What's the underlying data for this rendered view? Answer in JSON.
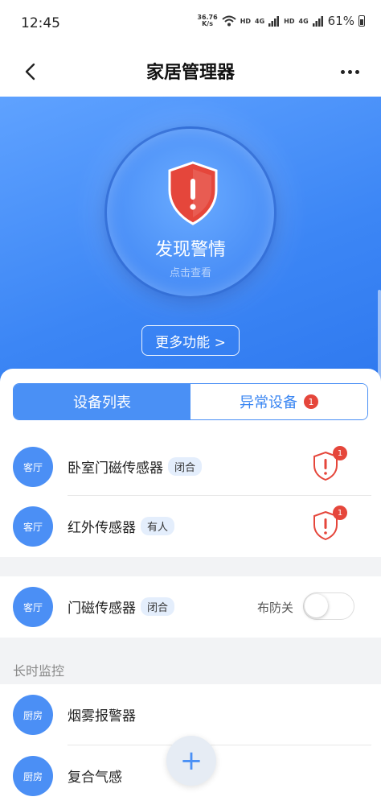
{
  "status_bar": {
    "time": "12:45",
    "net_speed_value": "36.76",
    "net_speed_unit": "K/s",
    "hd1": "HD",
    "net1": "4G",
    "hd2": "HD",
    "net2": "4G",
    "battery": "61%"
  },
  "nav": {
    "title": "家居管理器",
    "back_icon": "chevron-left-icon",
    "more_icon": "more-horizontal-icon"
  },
  "hero": {
    "status": "发现警情",
    "hint": "点击查看",
    "more_button": "更多功能 >",
    "alert_color": "#e5463b"
  },
  "tabs": [
    {
      "label": "设备列表",
      "active": true
    },
    {
      "label": "异常设备",
      "active": false,
      "badge": "1"
    }
  ],
  "alarm_devices": [
    {
      "room": "客厅",
      "name": "卧室门磁传感器",
      "tag": "闭合",
      "alert_count": "1"
    },
    {
      "room": "客厅",
      "name": "红外传感器",
      "tag": "有人",
      "alert_count": "1"
    }
  ],
  "armed_devices": [
    {
      "room": "客厅",
      "name": "门磁传感器",
      "tag": "闭合",
      "arm_label": "布防关",
      "arm_on": false
    }
  ],
  "monitor": {
    "header": "长时监控",
    "devices": [
      {
        "room": "厨房",
        "name": "烟雾报警器"
      },
      {
        "room": "厨房",
        "name": "复合气感"
      }
    ]
  },
  "fab": {
    "label": "+"
  },
  "colors": {
    "primary": "#4a90f5",
    "danger": "#e5463b"
  }
}
